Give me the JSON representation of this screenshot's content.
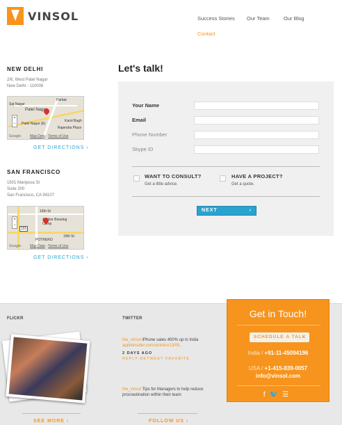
{
  "brand": {
    "name": "VINSOL",
    "accent": "#f7941d",
    "link": "#2aa3d0"
  },
  "nav": {
    "items": [
      "Success Stories",
      "Our Team",
      "Our Blog"
    ],
    "contact": "Contact"
  },
  "offices": [
    {
      "title": "NEW DELHI",
      "address": [
        "2/6, West Patel Nagar",
        "New Delhi - 110008"
      ],
      "map": {
        "labels": [
          "Parbat",
          "Patel Nagar",
          "Patel Nagar (E)",
          "Karol Bagh",
          "Rajendra Place",
          "Sat Nagar"
        ],
        "data_attr": "Map Data",
        "terms": "Terms of Use",
        "google": "Google"
      },
      "directions": "GET DIRECTIONS"
    },
    {
      "title": "SAN FRANCISCO",
      "address": [
        "1501 Mariposa St",
        "Suite 200",
        "San Francisco, CA 94107"
      ],
      "map": {
        "labels": [
          "16th St",
          "Anchor Brewing Comp",
          "POTRERO",
          "101",
          "19th St"
        ],
        "data_attr": "Map Data",
        "terms": "Terms of Use",
        "google": "Google"
      },
      "directions": "GET DIRECTIONS"
    }
  ],
  "form": {
    "title": "Let's talk!",
    "fields": [
      {
        "label": "Your Name",
        "value": "",
        "required": true
      },
      {
        "label": "Email",
        "value": "",
        "required": true
      },
      {
        "label": "Phone Number",
        "value": "",
        "required": false
      },
      {
        "label": "Skype ID",
        "value": "",
        "required": false
      }
    ],
    "options": [
      {
        "title": "WANT TO CONSULT?",
        "subtitle": "Get a little advice."
      },
      {
        "title": "HAVE A PROJECT?",
        "subtitle": "Get a quote."
      }
    ],
    "next": "NEXT"
  },
  "footer": {
    "flickr": {
      "heading": "FLICKR",
      "see_more": "SEE MORE"
    },
    "twitter": {
      "heading": "TWITTER",
      "tweets": [
        {
          "user": "the_vinsol",
          "text": " iPhone sales 400% up in India ",
          "link": "appleinsider.com/articles/13/05..",
          "ago": "2 DAYS AGO",
          "actions": "REPLY·RETWEET·FAVORITE"
        },
        {
          "user": "the_vinsol",
          "text": " Tips for Managers to help reduce procrastination within their team"
        }
      ],
      "follow": "FOLLOW US"
    },
    "touch": {
      "title": "Get in Touch!",
      "schedule": "SCHEDULE A TALK",
      "india_label": "India / ",
      "india_phone": "+91-11-45094196",
      "usa_label": "USA / ",
      "usa_phone": "+1-415-839-0057",
      "email": "info@vinsol.com",
      "social_icons": [
        "facebook-icon",
        "twitter-icon",
        "rss-icon"
      ]
    }
  }
}
